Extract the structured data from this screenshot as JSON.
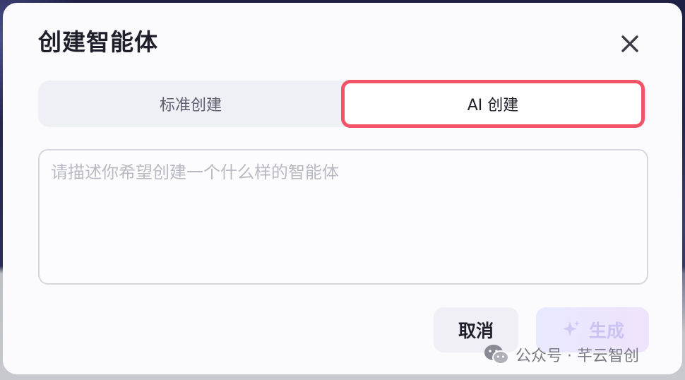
{
  "dialog": {
    "title": "创建智能体",
    "close_icon": "close-icon"
  },
  "tabs": [
    {
      "label": "标准创建",
      "selected": false
    },
    {
      "label": "AI 创建",
      "selected": true
    }
  ],
  "prompt": {
    "value": "",
    "placeholder": "请描述你希望创建一个什么样的智能体"
  },
  "actions": {
    "cancel_label": "取消",
    "generate_label": "生成",
    "generate_icon": "sparkle-icon"
  },
  "watermark": {
    "text": "公众号 · 芊云智创",
    "logo_icon": "wechat-icon"
  },
  "colors": {
    "highlight": "#f25467",
    "dialog_bg": "#fbfbfd",
    "tab_track": "#efeff6",
    "generate_text": "#cdc3f3"
  }
}
